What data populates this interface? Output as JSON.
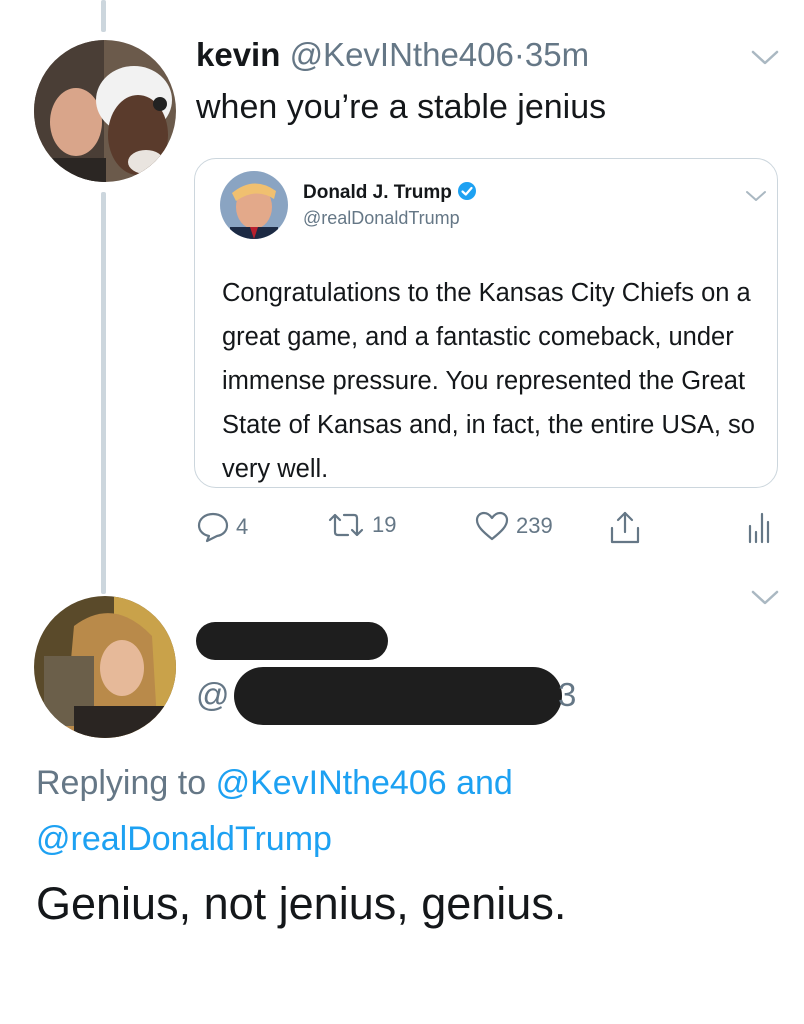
{
  "tweet1": {
    "display_name": "kevin",
    "handle": "@KevINthe406",
    "separator": "·",
    "time": "35m",
    "text": "when you’re a stable jenius",
    "avatar_icon": "person-with-dog-avatar"
  },
  "quoted": {
    "display_name": "Donald J. Trump",
    "verified_icon": "verified-badge-icon",
    "handle": "@realDonaldTrump",
    "text": "Congratulations to the Kansas City Chiefs on a great game, and a fantastic comeback, under immense pressure. You represented the Great State of Kansas and, in fact, the entire USA, so very well."
  },
  "actions": {
    "reply_count": "4",
    "retweet_count": "19",
    "like_count": "239",
    "icons": [
      "reply-icon",
      "retweet-icon",
      "like-icon",
      "share-icon",
      "analytics-icon"
    ]
  },
  "tweet2": {
    "handle_prefix": "@",
    "handle_suffix": "3",
    "replying_label": "Replying to",
    "reply_handle_1": "@KevINthe406",
    "conjunction": "and",
    "reply_handle_2": "@realDonaldTrump",
    "text": "Genius, not jenius, genius."
  },
  "colors": {
    "link": "#1da1f2",
    "secondary_text": "#657786",
    "thread_line": "#ccd6dd",
    "redaction": "#1e1e1e"
  }
}
